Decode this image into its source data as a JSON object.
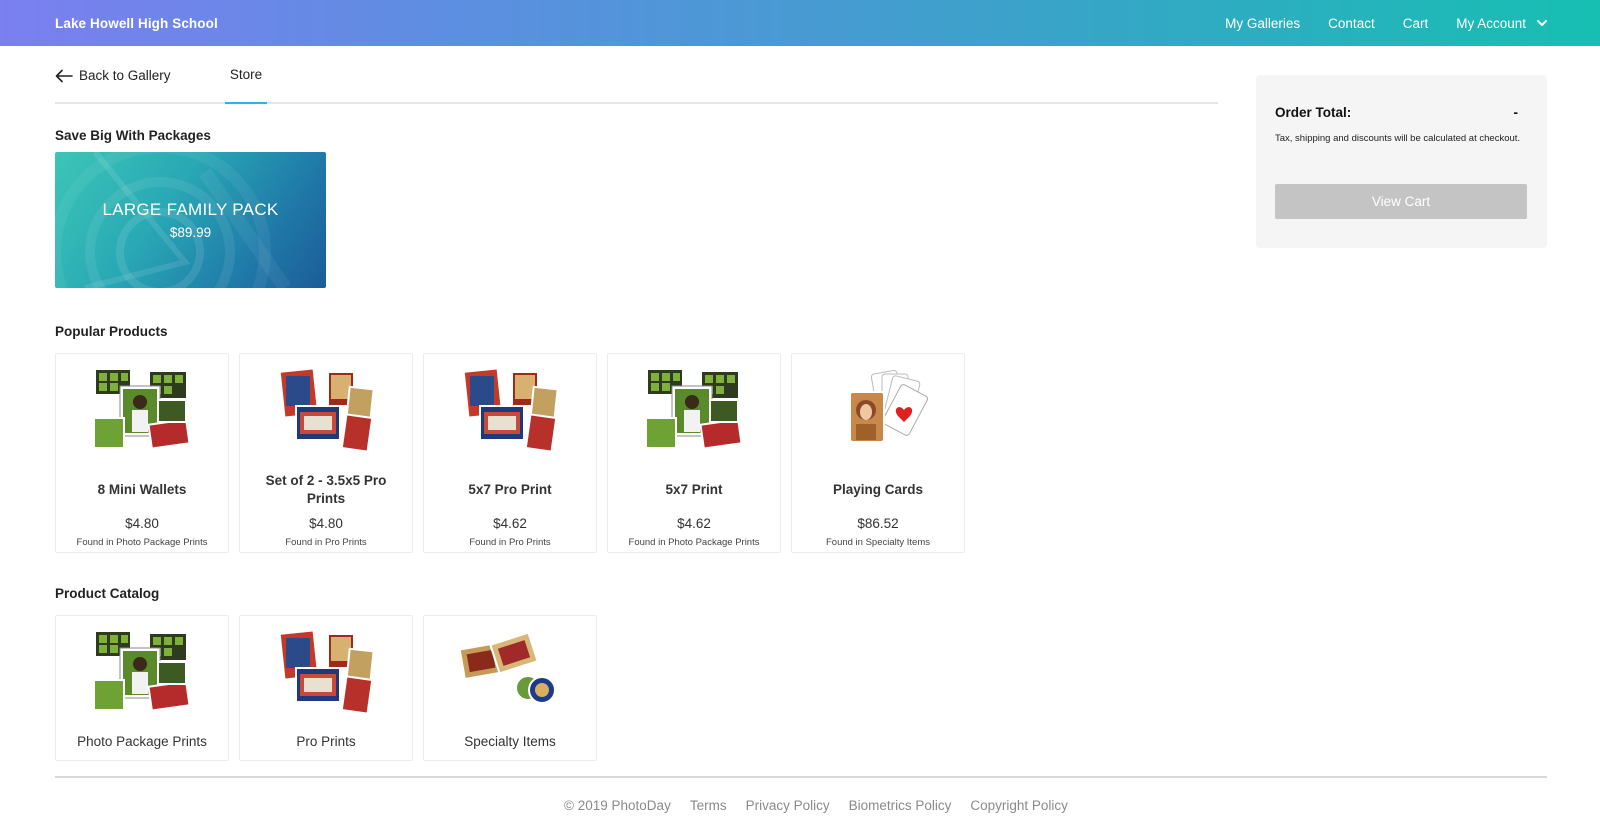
{
  "header": {
    "brand": "Lake Howell High School",
    "nav": {
      "galleries": "My Galleries",
      "contact": "Contact",
      "cart": "Cart",
      "account": "My Account"
    }
  },
  "tabs": {
    "back": "Back to Gallery",
    "store": "Store"
  },
  "packages": {
    "title": "Save Big With Packages",
    "items": [
      {
        "name": "LARGE FAMILY PACK",
        "price": "$89.99"
      }
    ]
  },
  "popular": {
    "title": "Popular Products",
    "items": [
      {
        "name": "8 Mini Wallets",
        "price": "$4.80",
        "found": "Found in Photo Package Prints",
        "icon": "wallets-thumbnail"
      },
      {
        "name": "Set of 2 - 3.5x5 Pro Prints",
        "price": "$4.80",
        "found": "Found in Pro Prints",
        "icon": "pro-prints-thumbnail"
      },
      {
        "name": "5x7 Pro Print",
        "price": "$4.62",
        "found": "Found in Pro Prints",
        "icon": "pro-prints-thumbnail"
      },
      {
        "name": "5x7 Print",
        "price": "$4.62",
        "found": "Found in Photo Package Prints",
        "icon": "wallets-thumbnail"
      },
      {
        "name": "Playing Cards",
        "price": "$86.52",
        "found": "Found in Specialty Items",
        "icon": "playing-cards-thumbnail"
      }
    ]
  },
  "catalog": {
    "title": "Product Catalog",
    "items": [
      {
        "name": "Photo Package Prints",
        "icon": "wallets-thumbnail"
      },
      {
        "name": "Pro Prints",
        "icon": "pro-prints-thumbnail"
      },
      {
        "name": "Specialty Items",
        "icon": "specialty-items-thumbnail"
      }
    ]
  },
  "order": {
    "label": "Order Total:",
    "value": "-",
    "note": "Tax, shipping and discounts will be calculated at checkout.",
    "button": "View Cart"
  },
  "footer": {
    "copyright": "© 2019 PhotoDay",
    "terms": "Terms",
    "privacy": "Privacy Policy",
    "biometrics": "Biometrics Policy",
    "copyright_policy": "Copyright Policy"
  },
  "colors": {
    "accent": "#2cb3e8",
    "button_disabled": "#c4c4c4",
    "header_start": "#7b7ff0",
    "header_end": "#16bfb2"
  }
}
